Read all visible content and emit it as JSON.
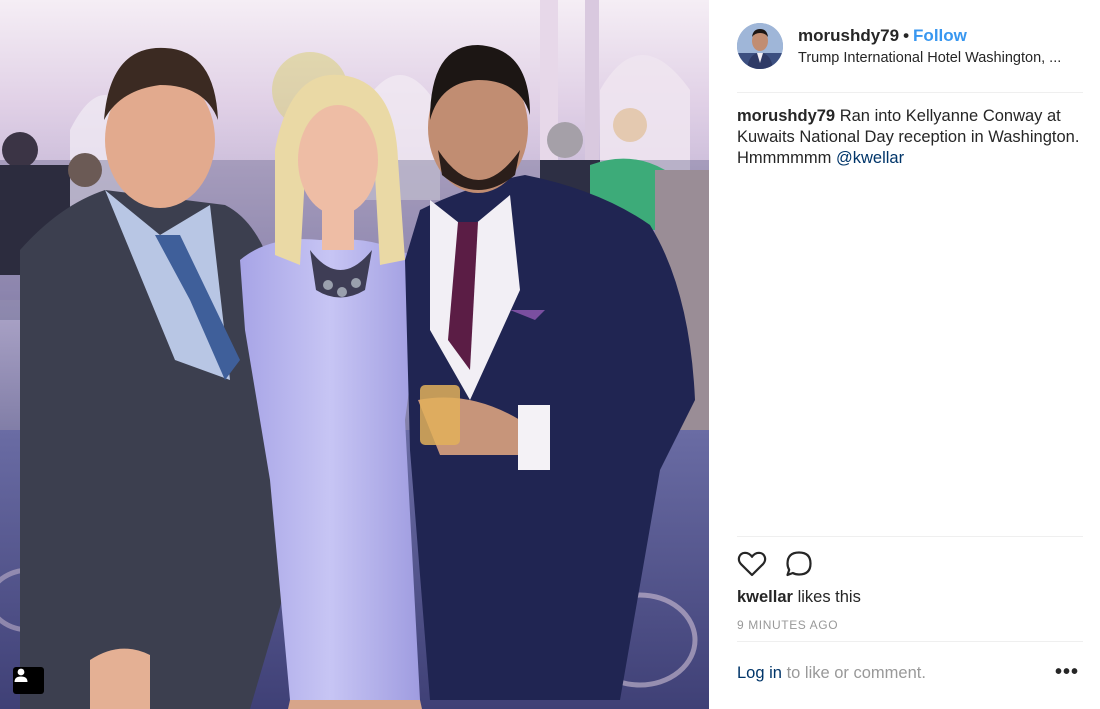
{
  "post": {
    "photo_alt": "",
    "header": {
      "username": "morushdy79",
      "separator": "•",
      "follow_label": "Follow",
      "location": "Trump International Hotel Washington, ..."
    },
    "caption": {
      "username": "morushdy79",
      "text": "Ran into Kellyanne Conway at Kuwaits National Day reception in Washington. Hmmmmmm",
      "mention": "@kwellar"
    },
    "actions": {
      "like_icon": "heart-icon",
      "comment_icon": "comment-bubble-icon"
    },
    "likes": {
      "user": "kwellar",
      "suffix": "likes this"
    },
    "timestamp": "9 MINUTES AGO",
    "footer": {
      "login_link": "Log in",
      "login_suffix": "to like or comment.",
      "more_icon": "more-options-icon",
      "more_label": "•••"
    },
    "tag_icon": "user-tag-icon",
    "colors": {
      "link_blue": "#3897f0",
      "mention_navy": "#003569",
      "muted_gray": "#999999"
    }
  }
}
